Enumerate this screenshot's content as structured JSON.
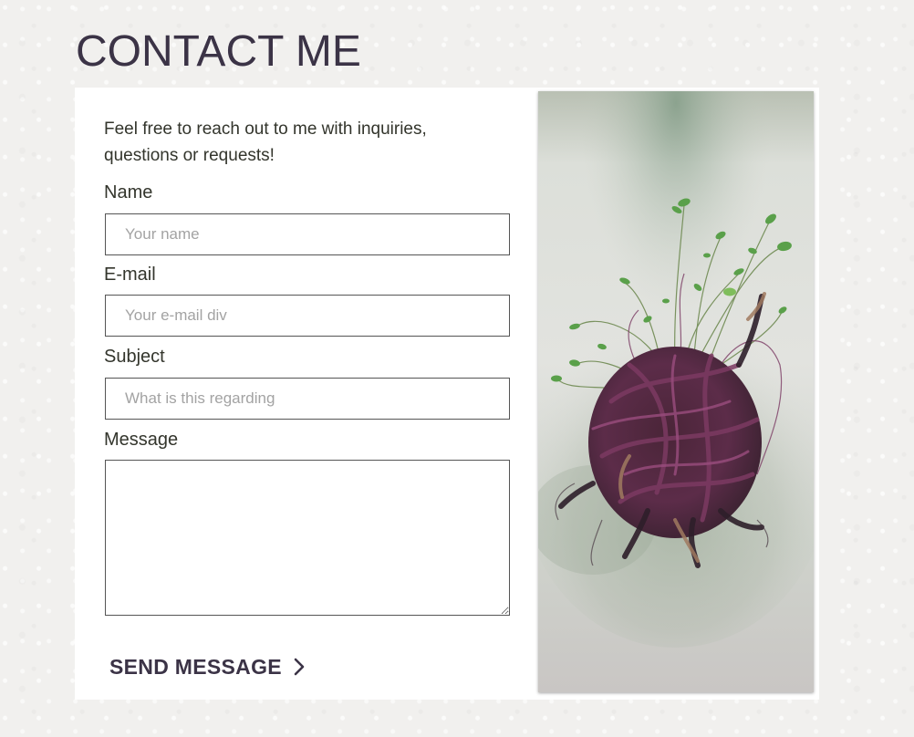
{
  "page": {
    "title": "CONTACT ME"
  },
  "form": {
    "intro": "Feel free to reach out to me with inquiries, questions or requests!",
    "fields": {
      "name": {
        "label": "Name",
        "placeholder": "Your name"
      },
      "email": {
        "label": "E-mail",
        "placeholder": "Your e-mail div"
      },
      "subject": {
        "label": "Subject",
        "placeholder": "What is this regarding"
      },
      "message": {
        "label": "Message",
        "placeholder": ""
      }
    },
    "submit_label": "SEND MESSAGE",
    "submit_icon": "chevron-right-icon"
  },
  "artwork": {
    "alt": "Painting of a tangled knot of dark purple roots with green sprouts on a misty grey-green background"
  },
  "colors": {
    "title": "#3b3346",
    "body_text": "#33352c",
    "background": "#f1f0ee",
    "card": "#ffffff"
  }
}
